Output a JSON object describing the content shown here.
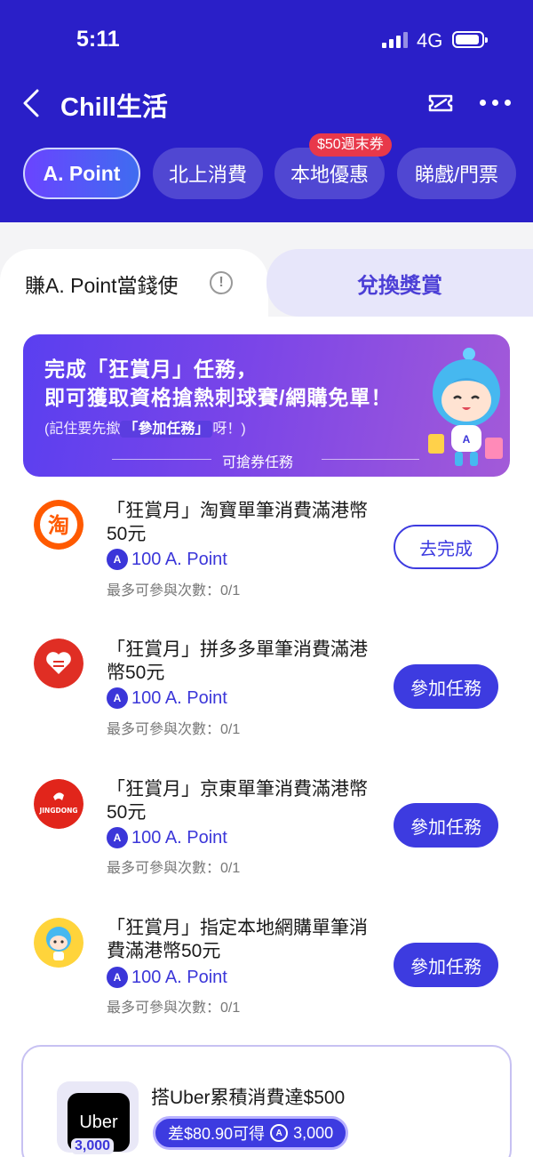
{
  "status_bar": {
    "time": "5:11",
    "network": "4G"
  },
  "nav": {
    "title": "Chill生活",
    "back_icon": "chevron-left-icon",
    "share_icon": "ticket-icon",
    "more_icon": "ellipsis-icon"
  },
  "tabs": [
    {
      "label": "A. Point",
      "active": true
    },
    {
      "label": "北上消費",
      "active": false
    },
    {
      "label": "本地優惠",
      "active": false
    },
    {
      "label": "睇戲/門票",
      "active": false
    }
  ],
  "tab_badge": "$50週末券",
  "segments": {
    "earn_label": "賺A. Point當錢使",
    "info_icon": "info-icon",
    "redeem_label": "兌換獎賞"
  },
  "banner": {
    "line1": "完成「狂賞月」任務，",
    "line2": "即可獲取資格搶熱刺球賽/網購免單！",
    "note_prefix": "(記住要先撳",
    "note_highlight": "「參加任務」",
    "note_suffix": "呀！)",
    "section_label": "可搶券任務"
  },
  "tasks": [
    {
      "title": "「狂賞月」淘寶單筆消費滿港幣50元",
      "points": "100 A. Point",
      "limit": "最多可參與次數：0/1",
      "button": "去完成",
      "logo": "taobao-logo-icon"
    },
    {
      "title": "「狂賞月」拼多多單筆消費滿港幣50元",
      "points": "100 A. Point",
      "limit": "最多可參與次數：0/1",
      "button": "參加任務",
      "logo": "pinduoduo-logo-icon"
    },
    {
      "title": "「狂賞月」京東單筆消費滿港幣50元",
      "points": "100 A. Point",
      "limit": "最多可參與次數：0/1",
      "button": "參加任務",
      "logo": "jingdong-logo-icon",
      "logo_text": "JINGDONG"
    },
    {
      "title": "「狂賞月」指定本地網購單筆消費滿港幣50元",
      "points": "100 A. Point",
      "limit": "最多可參與次數：0/1",
      "button": "參加任務",
      "logo": "mascot-logo-icon"
    }
  ],
  "uber": {
    "logo_text": "Uber",
    "points_badge": "3,000",
    "title": "搭Uber累積消費達$500",
    "progress_prefix": "差$80.90可得",
    "progress_points": "3,000"
  },
  "colors": {
    "header_bg": "#2a1fc8",
    "accent": "#3d3be0",
    "badge_red": "#e8384a"
  }
}
